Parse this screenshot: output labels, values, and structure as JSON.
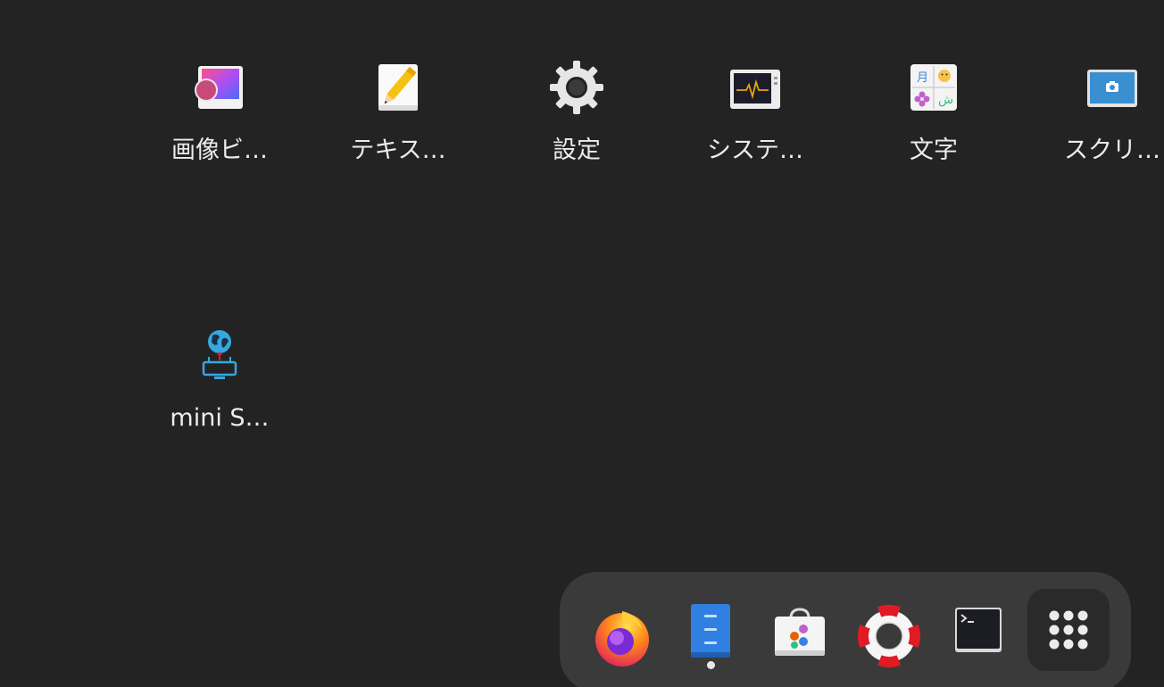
{
  "apps": [
    {
      "label": "画像ビ…",
      "icon": "image-viewer-icon"
    },
    {
      "label": "テキス…",
      "icon": "text-editor-icon"
    },
    {
      "label": "設定",
      "icon": "settings-gear-icon"
    },
    {
      "label": "システ…",
      "icon": "system-monitor-icon"
    },
    {
      "label": "文字",
      "icon": "characters-icon"
    },
    {
      "label": "スクリ…",
      "icon": "screenshot-icon"
    },
    {
      "label": "mini S…",
      "icon": "globe-network-icon"
    }
  ],
  "dock": {
    "items": [
      {
        "name": "firefox",
        "icon": "firefox-icon",
        "running": false
      },
      {
        "name": "files",
        "icon": "files-icon",
        "running": true
      },
      {
        "name": "software",
        "icon": "software-store-icon",
        "running": false
      },
      {
        "name": "help",
        "icon": "help-lifebuoy-icon",
        "running": false
      },
      {
        "name": "terminal",
        "icon": "terminal-icon",
        "running": false
      }
    ],
    "show_apps_icon": "show-apps-grid-icon"
  },
  "colors": {
    "background": "#232323",
    "dock": "#3a3a3a",
    "label": "#ececec"
  }
}
